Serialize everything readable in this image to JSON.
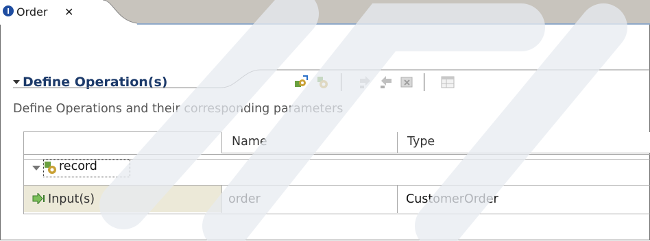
{
  "tab": {
    "icon_glyph": "I",
    "title": "Order",
    "close_glyph": "✕"
  },
  "section": {
    "title": "Define Operation(s)",
    "description": "Define Operations and their  corresponding parameters"
  },
  "toolbar": {
    "buttons": [
      {
        "icon": "add-operation-icon"
      },
      {
        "icon": "add-operation-alt-icon"
      },
      {
        "icon": "add-input-icon"
      },
      {
        "icon": "add-output-icon"
      },
      {
        "icon": "remove-icon"
      },
      {
        "icon": "table-properties-icon"
      }
    ]
  },
  "table": {
    "columns": [
      "Name",
      "Type"
    ],
    "operation": {
      "label": "record"
    },
    "input_row": {
      "label": "Input(s)",
      "name": "order",
      "type": "CustomerOrder"
    }
  },
  "colors": {
    "section_title": "#1c3a6a",
    "tab_strip": "#c8c4bd",
    "tab_underline": "#8ea8c8",
    "row_highlight": "#ece9d8"
  }
}
